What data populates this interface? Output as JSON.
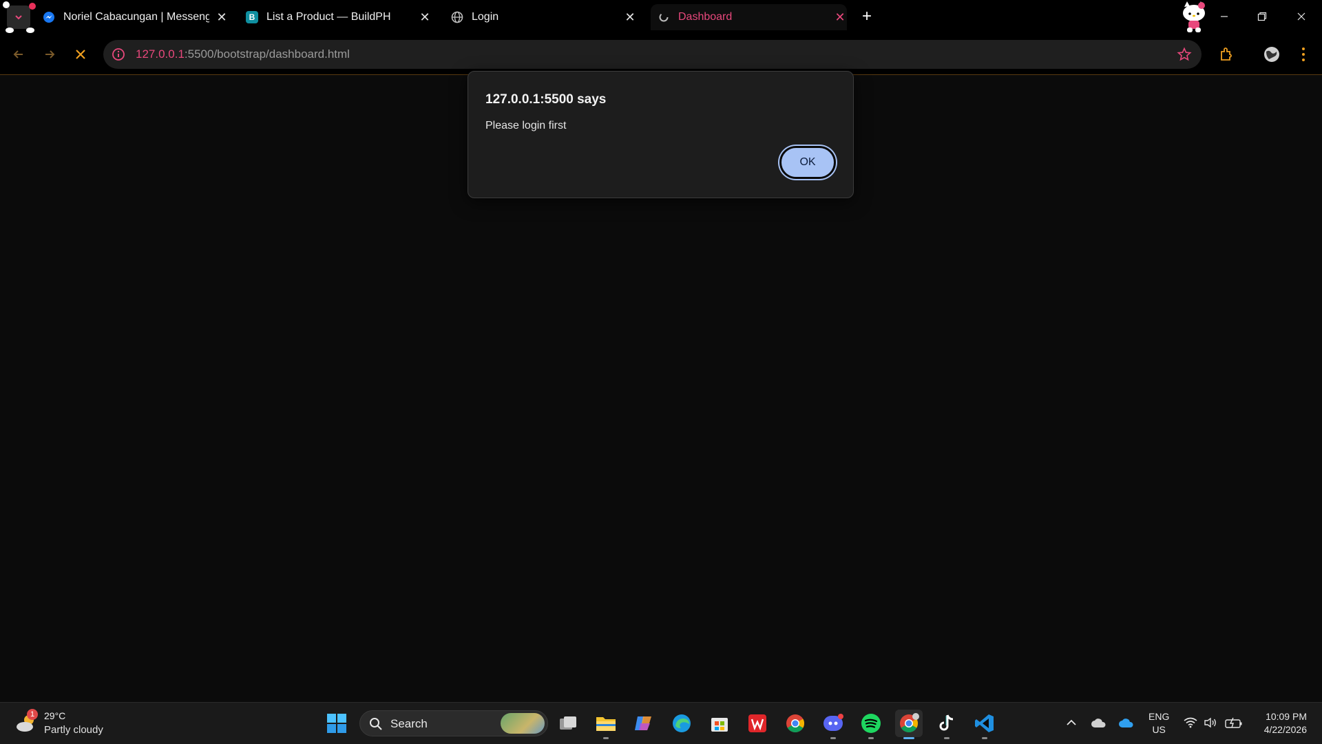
{
  "browser": {
    "tabs": [
      {
        "title": "Noriel Cabacungan | Messenger",
        "icon": "messenger-icon",
        "active": false
      },
      {
        "title": "List a Product — BuildPH",
        "icon": "buildph-icon",
        "favicon_letter": "B",
        "active": false
      },
      {
        "title": "Login",
        "icon": "globe-icon",
        "active": false
      },
      {
        "title": "Dashboard",
        "icon": "loading-icon",
        "active": true
      }
    ],
    "address": {
      "host": "127.0.0.1",
      "rest": ":5500/bootstrap/dashboard.html"
    }
  },
  "dialog": {
    "title": "127.0.0.1:5500 says",
    "message": "Please login first",
    "ok_label": "OK"
  },
  "taskbar": {
    "weather": {
      "temp": "29°C",
      "condition": "Partly cloudy",
      "badge": "1"
    },
    "search_label": "Search",
    "pinned": [
      "task-view-icon",
      "file-explorer-icon",
      "copilot-icon",
      "edge-icon",
      "store-icon",
      "wps-icon",
      "chrome-icon",
      "discord-icon",
      "spotify-icon",
      "chrome-active-icon",
      "tiktok-icon",
      "vscode-icon"
    ],
    "language": {
      "line1": "ENG",
      "line2": "US"
    },
    "clock": {
      "time": "10:09 PM",
      "date": "4/22/2026"
    }
  },
  "colors": {
    "accent_pink": "#e8487c",
    "ok_button": "#a8c3f5",
    "background": "#0b0b0b"
  }
}
